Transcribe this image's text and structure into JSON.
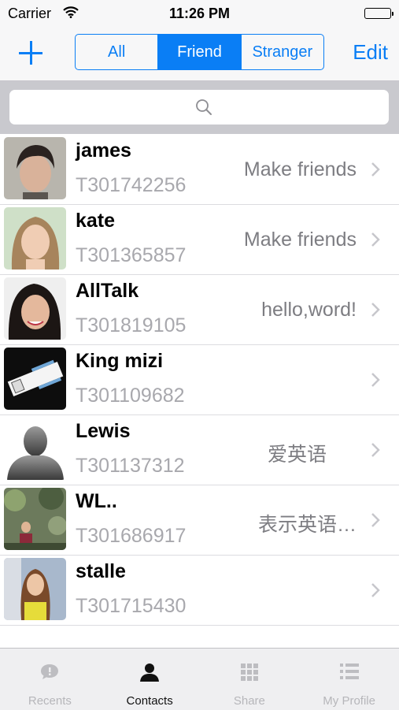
{
  "status_bar": {
    "carrier": "Carrier",
    "time": "11:26 PM"
  },
  "nav": {
    "segments": [
      "All",
      "Friend",
      "Stranger"
    ],
    "selected_segment": "Friend",
    "edit_label": "Edit",
    "accent_color": "#0a7ef5"
  },
  "search": {
    "placeholder": ""
  },
  "contacts": [
    {
      "name": "james",
      "id": "T301742256",
      "status": "Make friends"
    },
    {
      "name": "kate",
      "id": "T301365857",
      "status": "Make friends"
    },
    {
      "name": "AllTalk",
      "id": "T301819105",
      "status": "hello,word!"
    },
    {
      "name": "King mizi",
      "id": "T301109682",
      "status": ""
    },
    {
      "name": "Lewis",
      "id": "T301137312",
      "status": "爱英语"
    },
    {
      "name": "WL..",
      "id": "T301686917",
      "status": "表示英语…"
    },
    {
      "name": "stalle",
      "id": "T301715430",
      "status": ""
    }
  ],
  "tabbar": {
    "tabs": [
      {
        "label": "Recents",
        "icon": "chat-bubble-icon"
      },
      {
        "label": "Contacts",
        "icon": "person-icon"
      },
      {
        "label": "Share",
        "icon": "grid-icon"
      },
      {
        "label": "My Profile",
        "icon": "list-icon"
      }
    ],
    "active": "Contacts"
  }
}
